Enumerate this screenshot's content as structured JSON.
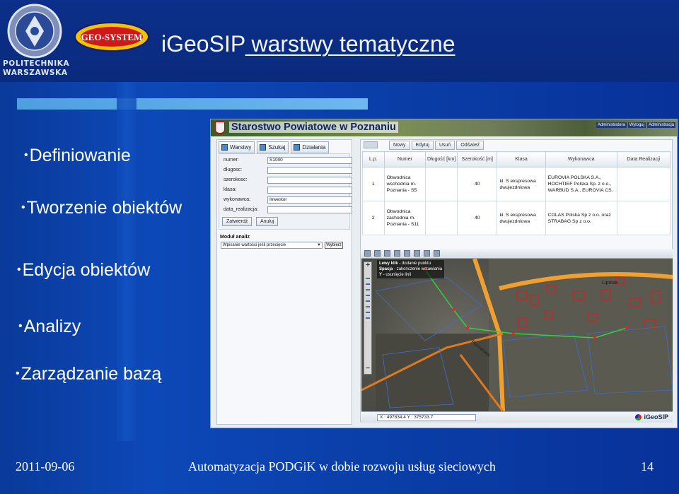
{
  "header": {
    "institution_text": [
      "POLITECHNIKA",
      "WARSZAWSKA"
    ],
    "company_logo_text": "GEO-SYSTEM",
    "title_prefix": "iGeoSIP",
    "title_underlined": " warstwy tematyczne"
  },
  "bullets": [
    "Definiowanie",
    "Tworzenie obiektów",
    "Edycja obiektów",
    "Analizy",
    "Zarządzanie bazą"
  ],
  "app": {
    "banner_title": "Starostwo Powiatowe w Poznaniu",
    "banner_links": [
      "Administratora",
      "Wyloguj",
      "Administracja"
    ],
    "left_tabs": [
      "Warstwy",
      "Szukaj",
      "Działania"
    ],
    "form": [
      {
        "label": "numer:",
        "value": "S1000"
      },
      {
        "label": "długosc:",
        "value": ""
      },
      {
        "label": "szerokosc:",
        "value": ""
      },
      {
        "label": "klasa:",
        "value": ""
      },
      {
        "label": "wykonawca:",
        "value": "Inwestor"
      },
      {
        "label": "data_realizacja:",
        "value": ""
      }
    ],
    "confirm_label": "Zatwierdź",
    "cancel_label": "Anuluj",
    "analysis_module_label": "Moduł analiz",
    "analysis_select_value": "Wpisanie wartości jeśli przecięcie",
    "analysis_select_button": "Wybierz",
    "grid_tabs": [
      "Nowy",
      "Edytuj",
      "Usuń",
      "Odśwież"
    ],
    "table": {
      "headers": [
        "L.p.",
        "Numer",
        "Długość [km]",
        "Szerokość [m]",
        "Klasa",
        "Wykonawca",
        "Data Realizacji"
      ],
      "rows": [
        [
          "1",
          "Obwodnica wschodnia m. Poznania - S5",
          "",
          "40",
          "kl. S ekspresowa dwujezdniowa",
          "EUROVIA POLSKA S.A., HOCHTIEF Polska Sp. z o.o., WARBUD S.A., EUROVIA CS.",
          ""
        ],
        [
          "2",
          "Obwodnica zachodnia m. Poznania - S11",
          "",
          "40",
          "kl. S ekspresowa dwujezdniowa",
          "COLAS Polska Sp z o.o. oraz STRABAG Sp z o.o.",
          ""
        ]
      ]
    },
    "map_hint": [
      {
        "key": "Lewy klik",
        "text": "- dodanie punktu"
      },
      {
        "key": "Spacja",
        "text": "- zakończenie wstawiania"
      },
      {
        "key": "Y",
        "text": "- usunięcie linii"
      }
    ],
    "map_street_label": "Lipowa",
    "map_road_label": "Poznańska",
    "coords_text": "X : 497834.4 Y : 375733.7",
    "brand": "iGeoSIP"
  },
  "footer": {
    "date": "2011-09-06",
    "center": "Automatyzacja PODGiK w dobie rozwoju usług sieciowych",
    "page": "14"
  },
  "colors": {
    "background": "#0d48b8",
    "accent_bar": "#6db8ef",
    "route": "#2fd23a"
  }
}
